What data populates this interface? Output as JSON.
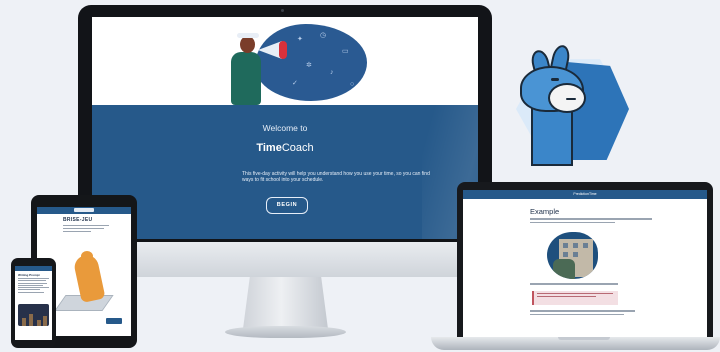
{
  "desktop": {
    "welcome_text": "Welcome to",
    "brand_bold": "Time",
    "brand_regular": "Coach",
    "intro_text": "This five-day activity will help you understand how you use your time, so you can find ways to fit school into your schedule.",
    "begin_label": "BEGIN"
  },
  "laptop": {
    "nav_title": "PredictionTime",
    "page_title": "Example"
  },
  "tablet": {
    "page_title": "BRISE-JEU"
  },
  "phone": {
    "page_title": "Writing Prompt"
  },
  "colors": {
    "brand_blue": "#26598a",
    "llama_blue": "#3b86c9",
    "hex_light": "#dbeaf9"
  },
  "icons": [
    "megaphone-icon",
    "llama-mascot-icon",
    "cat-illustration-icon"
  ]
}
